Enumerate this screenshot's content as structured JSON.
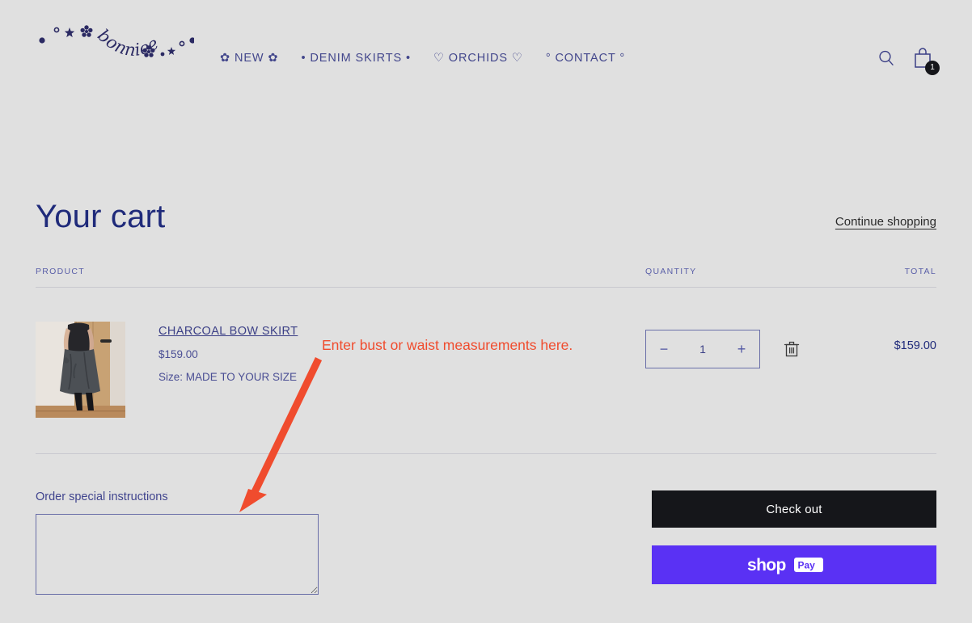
{
  "theme": {
    "background": "#e0e0e0",
    "navy": "#27296d",
    "accent_red": "#f04c2e",
    "shop_pay_purple": "#5a31f4",
    "checkout_black": "#15161a"
  },
  "header": {
    "logo_text": "bonniee",
    "logo_alt": "bonniee-logo",
    "nav": [
      {
        "label": "✿ NEW ✿",
        "name": "nav-new"
      },
      {
        "label": "• DENIM SKIRTS •",
        "name": "nav-denim-skirts"
      },
      {
        "label": "♡ ORCHIDS ♡",
        "name": "nav-orchids"
      },
      {
        "label": "° CONTACT °",
        "name": "nav-contact"
      }
    ],
    "search_icon": "search-icon",
    "cart_icon": "shopping-bag-icon",
    "cart_count": "1"
  },
  "cart": {
    "title": "Your cart",
    "continue_shopping": "Continue shopping",
    "columns": {
      "product": "PRODUCT",
      "quantity": "QUANTITY",
      "total": "TOTAL"
    },
    "items": [
      {
        "title": "CHARCOAL BOW SKIRT",
        "price": "$159.00",
        "variant": "Size: MADE TO YOUR SIZE",
        "quantity": "1",
        "total": "$159.00",
        "image_alt": "charcoal-bow-skirt-thumbnail",
        "decrease_label": "−",
        "increase_label": "+",
        "remove_icon": "trash-icon"
      }
    ],
    "notes_label": "Order special instructions",
    "notes_value": "",
    "notes_placeholder": "",
    "checkout_label": "Check out",
    "shop_pay_label": "shop Pay"
  },
  "annotation": {
    "text": "Enter bust or waist measurements here.",
    "arrow_name": "red-arrow-annotation",
    "color": "#f04c2e"
  }
}
